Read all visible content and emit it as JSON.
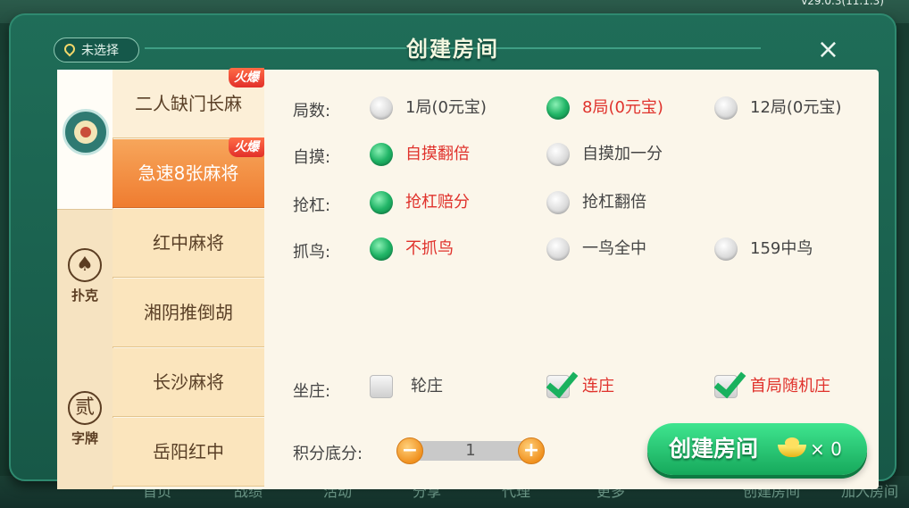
{
  "background": {
    "version": "v29.0.3(11.1.3)",
    "bottom_items": [
      "首页",
      "战绩",
      "活动",
      "分享",
      "代理",
      "更多",
      "创建房间",
      "加入房间"
    ]
  },
  "dialog": {
    "title": "创建房间",
    "location_label": "未选择",
    "close_label": "×"
  },
  "categories": [
    {
      "label": "",
      "icon": "mahjong-icon",
      "active": true
    },
    {
      "label": "扑克",
      "icon": "spade-icon",
      "glyph": "♠",
      "active": false
    },
    {
      "label": "字牌",
      "icon": "zipai-icon",
      "glyph": "贰",
      "active": false
    }
  ],
  "games": [
    {
      "label": "二人缺门长麻",
      "badge": "火爆",
      "active": false
    },
    {
      "label": "急速8张麻将",
      "badge": "火爆",
      "active": true
    },
    {
      "label": "红中麻将",
      "badge": "",
      "active": false
    },
    {
      "label": "湘阴推倒胡",
      "badge": "",
      "active": false
    },
    {
      "label": "长沙麻将",
      "badge": "",
      "active": false
    },
    {
      "label": "岳阳红中",
      "badge": "",
      "active": false
    }
  ],
  "options": {
    "rounds": {
      "label": "局数:",
      "choices": [
        "1局(0元宝)",
        "8局(0元宝)",
        "12局(0元宝)"
      ],
      "selected": 1
    },
    "zimo": {
      "label": "自摸:",
      "choices": [
        "自摸翻倍",
        "自摸加一分"
      ],
      "selected": 0
    },
    "qianggang": {
      "label": "抢杠:",
      "choices": [
        "抢杠赔分",
        "抢杠翻倍"
      ],
      "selected": 0
    },
    "zhuaniao": {
      "label": "抓鸟:",
      "choices": [
        "不抓鸟",
        "一鸟全中",
        "159中鸟"
      ],
      "selected": 0
    },
    "zuozhuang": {
      "label": "坐庄:",
      "choices": [
        "轮庄",
        "连庄",
        "首局随机庄"
      ],
      "checked": [
        false,
        true,
        true
      ]
    }
  },
  "score": {
    "label": "积分底分:",
    "value": "1",
    "minus": "−",
    "plus": "+"
  },
  "create_button": {
    "label": "创建房间",
    "cost": "× 0"
  },
  "colors": {
    "selected_text": "#e0322c",
    "accent_green": "#16a85b",
    "tab_orange": "#ef7c30"
  }
}
